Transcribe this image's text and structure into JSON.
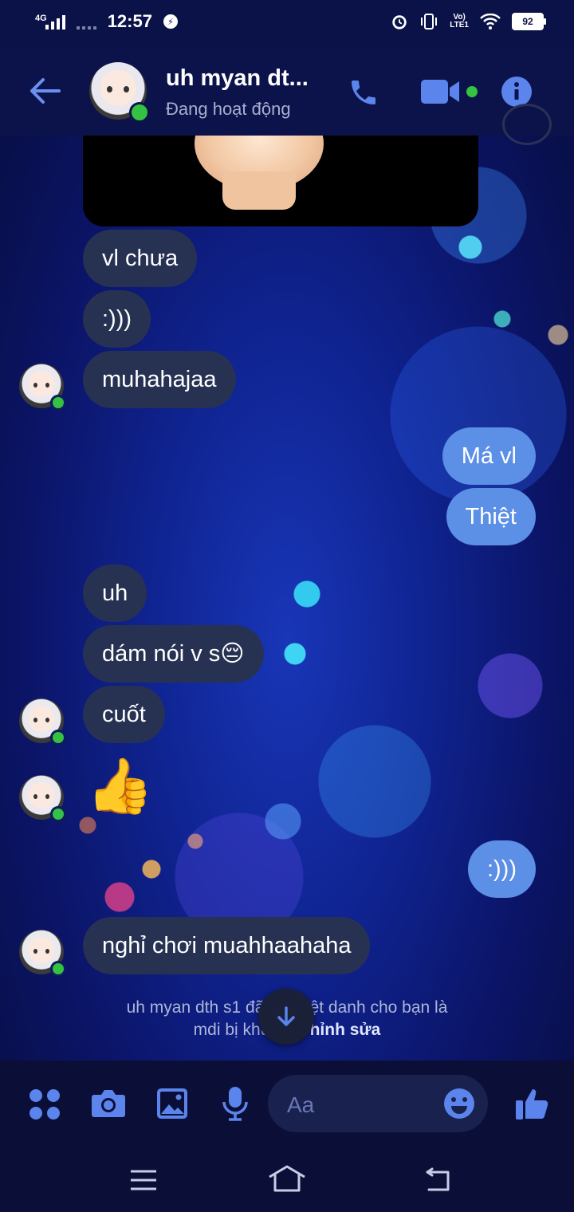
{
  "status_bar": {
    "network": "4G",
    "time": "12:57",
    "battery": "92"
  },
  "header": {
    "contact_name": "uh myan dt...",
    "contact_status": "Đang hoạt động"
  },
  "messages": [
    {
      "side": "in",
      "text": "vl chưa"
    },
    {
      "side": "in",
      "text": ":)))"
    },
    {
      "side": "in",
      "text": "muhahajaa"
    },
    {
      "side": "out",
      "text": "Má vl"
    },
    {
      "side": "out",
      "text": "Thiệt"
    },
    {
      "side": "in",
      "text": "uh"
    },
    {
      "side": "in",
      "text": "dám nói v s😔"
    },
    {
      "side": "in",
      "text": "cuốt"
    },
    {
      "side": "in",
      "text": "👍"
    },
    {
      "side": "out",
      "text": ":)))"
    },
    {
      "side": "in",
      "text": "nghỉ chơi muahhaahaha"
    }
  ],
  "system_note": {
    "line1": "uh myan dth s1 đã đặt biệt danh cho bạn là",
    "line2": "mdi bị khùng.",
    "edit_label": "Chỉnh sửa"
  },
  "composer": {
    "placeholder": "Aa"
  },
  "icons": {
    "back": "back-arrow-icon",
    "call": "phone-icon",
    "video": "video-camera-icon",
    "info": "info-icon",
    "apps": "apps-icon",
    "camera": "camera-icon",
    "gallery": "image-icon",
    "mic": "microphone-icon",
    "emoji": "emoji-icon",
    "like": "like-icon"
  },
  "colors": {
    "incoming_bubble": "#273253",
    "outgoing_bubble": "#5c8fe6",
    "accent": "#5c8fe6",
    "online": "#34c242"
  }
}
